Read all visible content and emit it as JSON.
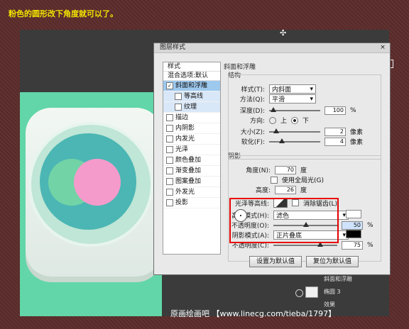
{
  "caption": "粉色的圆形改下角度就可以了。",
  "footer": "原画绘画吧 【www.linecg.com/tieba/1797】",
  "dialog": {
    "title": "图层样式",
    "styles_header": "样式",
    "blend_default": "混合选项:默认",
    "items": [
      {
        "label": "斜面和浮雕",
        "checked": true
      },
      {
        "label": "等高线",
        "checked": false
      },
      {
        "label": "纹理",
        "checked": false
      },
      {
        "label": "描边",
        "checked": false
      },
      {
        "label": "内阴影",
        "checked": false
      },
      {
        "label": "内发光",
        "checked": false
      },
      {
        "label": "光泽",
        "checked": false
      },
      {
        "label": "颜色叠加",
        "checked": false
      },
      {
        "label": "渐变叠加",
        "checked": false
      },
      {
        "label": "图案叠加",
        "checked": false
      },
      {
        "label": "外发光",
        "checked": false
      },
      {
        "label": "投影",
        "checked": false
      }
    ],
    "section_title": "斜面和浮雕",
    "structure_title": "结构",
    "style_label": "样式(T):",
    "style_value": "内斜面",
    "method_label": "方法(Q):",
    "method_value": "平滑",
    "depth_label": "深度(D):",
    "depth_value": "100",
    "depth_unit": "%",
    "direction_label": "方向:",
    "dir_up": "上",
    "dir_down": "下",
    "size_label": "大小(Z):",
    "size_value": "2",
    "size_unit": "像素",
    "soften_label": "软化(F):",
    "soften_value": "4",
    "soften_unit": "像素",
    "shadow_title": "阴影",
    "angle_label": "角度(N):",
    "angle_value": "70",
    "angle_unit": "度",
    "global_light": "使用全局光(G)",
    "altitude_label": "高度:",
    "altitude_value": "26",
    "altitude_unit": "度",
    "gloss_label": "光泽等高线:",
    "antialias": "消除锯齿(L)",
    "highlight_mode_label": "高光模式(H):",
    "highlight_mode_value": "滤色",
    "opacity_label1": "不透明度(O):",
    "opacity_value1": "50",
    "shadow_mode_label": "阴影模式(A):",
    "shadow_mode_value": "正片叠底",
    "opacity_label2": "不透明度(C):",
    "opacity_value2": "75",
    "percent": "%",
    "set_default": "设置为默认值",
    "reset_default": "复位为默认值"
  },
  "layers": {
    "row1": "斜面和浮雕",
    "row2": "椭圆 3",
    "row3": "效果"
  },
  "colors": {
    "background": "#5b2b2b",
    "canvas_dark": "#3b3b3b",
    "mint": "#62d6a8",
    "pink": "#f49bcb",
    "green": "#72d3a6",
    "teal": "#4bb6b4",
    "red_box": "#e60000",
    "selected": "#9ec9ef",
    "highlight_color": "#ffffff",
    "shadow_color": "#000000"
  }
}
